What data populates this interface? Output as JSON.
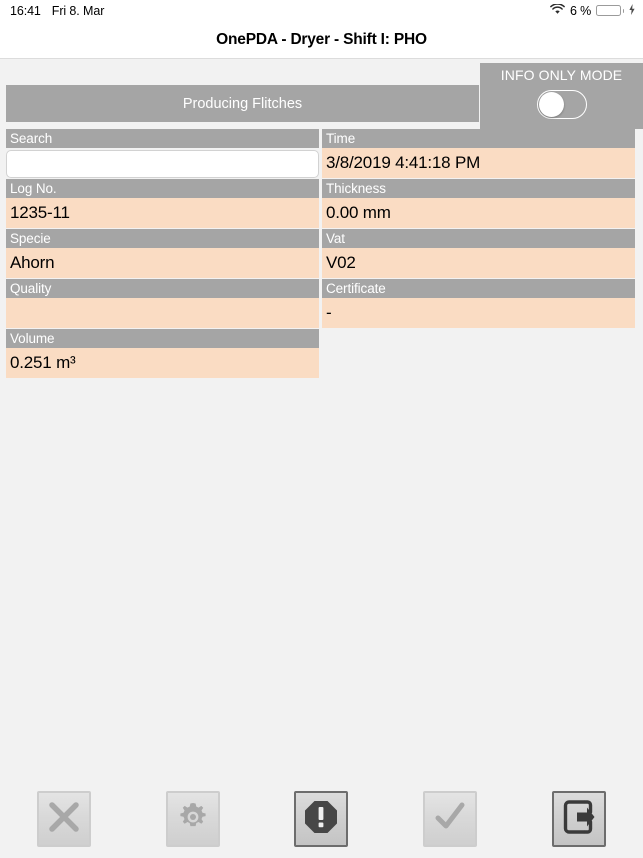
{
  "statusbar": {
    "time": "16:41",
    "date": "Fri 8. Mar",
    "wifi_icon": "wifi-icon",
    "battery_percent": "6 %",
    "battery_level": 6,
    "battery_icon": "battery-icon",
    "charging_icon": "lightning-bolt-icon"
  },
  "header": {
    "title": "OnePDA - Dryer - Shift I: PHO"
  },
  "topbar": {
    "mode_button_label": "Producing Flitches",
    "info_only_label": "INFO ONLY MODE",
    "info_only_enabled": false,
    "toggle_icon": "toggle-switch-icon"
  },
  "form": {
    "search": {
      "label": "Search",
      "value": "",
      "placeholder": ""
    },
    "time": {
      "label": "Time",
      "value": "3/8/2019 4:41:18 PM"
    },
    "log_no": {
      "label": "Log No.",
      "value": "1235-11"
    },
    "thickness": {
      "label": "Thickness",
      "value": "0.00 mm"
    },
    "specie": {
      "label": "Specie",
      "value": "Ahorn"
    },
    "vat": {
      "label": "Vat",
      "value": "V02"
    },
    "quality": {
      "label": "Quality",
      "value": ""
    },
    "certificate": {
      "label": "Certificate",
      "value": "-"
    },
    "volume": {
      "label": "Volume",
      "value": "0.251 m³"
    }
  },
  "toolbar": {
    "buttons": [
      {
        "name": "cancel-button",
        "icon": "close-x-icon",
        "style": "light"
      },
      {
        "name": "settings-button",
        "icon": "gear-icon",
        "style": "light"
      },
      {
        "name": "alert-button",
        "icon": "warning-octagon-icon",
        "style": "dark"
      },
      {
        "name": "confirm-button",
        "icon": "checkmark-icon",
        "style": "light"
      },
      {
        "name": "exit-button",
        "icon": "exit-arrow-icon",
        "style": "dark"
      }
    ]
  },
  "colors": {
    "page_background": "#f2f2f2",
    "label_gray": "#a5a5a5",
    "value_peach": "#fadcc3",
    "battery_red": "#fb0007",
    "white": "#ffffff"
  }
}
